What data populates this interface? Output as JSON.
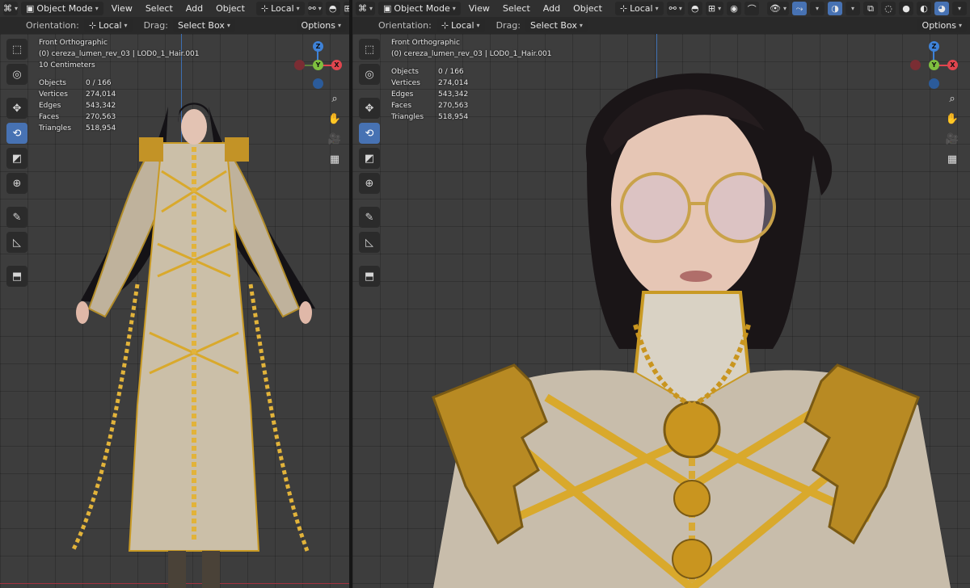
{
  "header": {
    "mode_label": "Object Mode",
    "menus": [
      "View",
      "Select",
      "Add",
      "Object"
    ],
    "transform_orientation": "Local"
  },
  "subheader": {
    "orientation_label": "Orientation:",
    "orientation_value": "Local",
    "drag_label": "Drag:",
    "drag_value": "Select Box",
    "options_label": "Options"
  },
  "left_view": {
    "view_name": "Front Orthographic",
    "object_path": "(0) cereza_lumen_rev_03 | LOD0_1_Hair.001",
    "grid_scale": "10 Centimeters",
    "stats": [
      {
        "label": "Objects",
        "value": "0 / 166"
      },
      {
        "label": "Vertices",
        "value": "274,014"
      },
      {
        "label": "Edges",
        "value": "543,342"
      },
      {
        "label": "Faces",
        "value": "270,563"
      },
      {
        "label": "Triangles",
        "value": "518,954"
      }
    ]
  },
  "right_view": {
    "view_name": "Front Orthographic",
    "object_path": "(0) cereza_lumen_rev_03 | LOD0_1_Hair.001",
    "stats": [
      {
        "label": "Objects",
        "value": "0 / 166"
      },
      {
        "label": "Vertices",
        "value": "274,014"
      },
      {
        "label": "Edges",
        "value": "543,342"
      },
      {
        "label": "Faces",
        "value": "270,563"
      },
      {
        "label": "Triangles",
        "value": "518,954"
      }
    ]
  },
  "gizmo": {
    "x_label": "X",
    "y_label": "Y",
    "z_label": "Z"
  },
  "colors": {
    "active_tool": "#4772b3",
    "x_axis": "#e0454e",
    "y_axis": "#7fbf3f",
    "z_axis": "#3e82d8",
    "header_bg": "#303030"
  },
  "icons": {
    "toolbar": [
      "select-box-icon",
      "cursor-icon",
      "move-icon",
      "rotate-icon",
      "scale-icon",
      "transform-icon",
      "annotate-icon",
      "measure-icon",
      "add-cube-icon"
    ],
    "navigation": [
      "zoom-icon",
      "hand-pan-icon",
      "camera-icon",
      "grid-icon"
    ]
  }
}
